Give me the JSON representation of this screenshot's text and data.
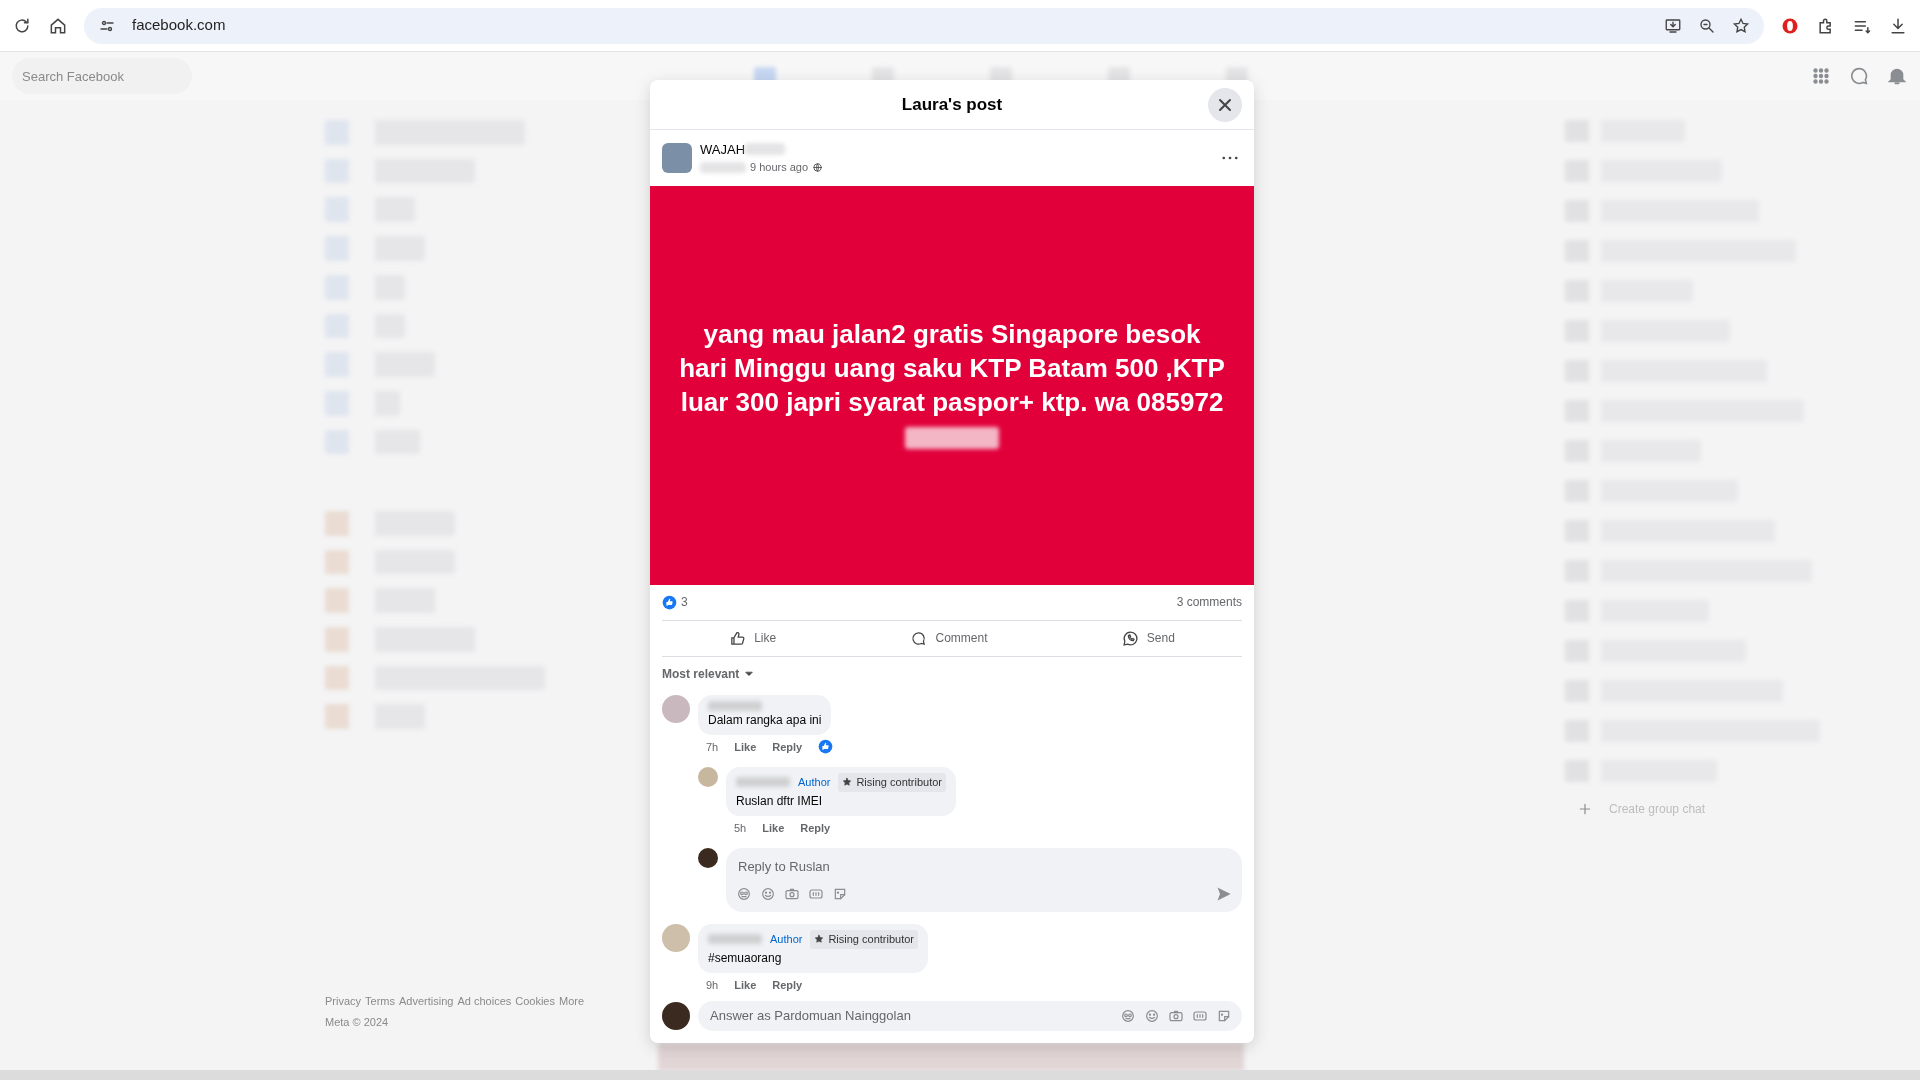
{
  "browser": {
    "url": "facebook.com"
  },
  "facebook": {
    "search": {
      "placeholder": "Search Facebook"
    },
    "create_group": "Create group chat",
    "footer_links": [
      "Privacy",
      "Terms",
      "Advertising",
      "Ad choices",
      "Cookies",
      "More"
    ],
    "copyright": "Meta © 2024"
  },
  "post_dialog": {
    "title": "Laura's post",
    "author": {
      "name": "WAJAH"
    },
    "time": "9 hours ago",
    "text": "yang mau jalan2 gratis Singapore besok hari Minggu uang saku KTP Batam 500 ,KTP luar 300 japri syarat paspor+ ktp. wa 085972",
    "reaction_count": "3",
    "comments_count": "3 comments",
    "actions": [
      {
        "kind": "like",
        "label": "Like"
      },
      {
        "kind": "comment",
        "label": "Comment"
      },
      {
        "kind": "send",
        "label": "Send"
      }
    ],
    "sort": "Most relevant",
    "comments": [
      {
        "text": "Dalam rangka apa ini",
        "time": "7h",
        "like": "Like",
        "reply": "Reply",
        "liked": true,
        "replies": [
          {
            "text": "Ruslan dftr IMEI",
            "badges": [
              {
                "kind": "author",
                "label": "Author"
              },
              {
                "kind": "contributor",
                "label": "Rising contributor"
              }
            ],
            "time": "5h",
            "like": "Like",
            "reply": "Reply",
            "liked": false
          }
        ],
        "reply_box": {
          "placeholder": "Reply to Ruslan"
        }
      },
      {
        "text": "#semuaorang",
        "badges": [
          {
            "kind": "author",
            "label": "Author"
          },
          {
            "kind": "contributor",
            "label": "Rising contributor"
          }
        ],
        "time": "9h",
        "like": "Like",
        "reply": "Reply",
        "liked": false
      }
    ],
    "answer_box": {
      "placeholder": "Answer as Pardomuan Nainggolan"
    }
  }
}
